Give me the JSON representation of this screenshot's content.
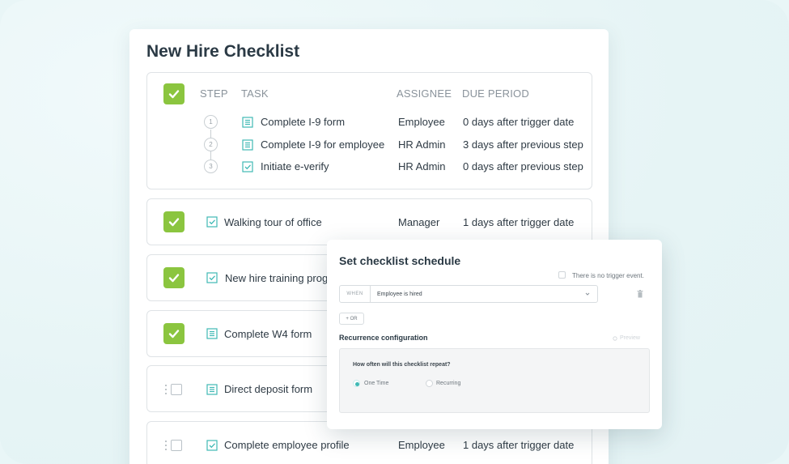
{
  "checklist": {
    "title": "New Hire Checklist",
    "headers": {
      "step": "STEP",
      "task": "TASK",
      "assignee": "ASSIGNEE",
      "due": "DUE PERIOD"
    },
    "group_steps": [
      {
        "num": "1",
        "icon": "form-icon",
        "task": "Complete I-9 form",
        "assignee": "Employee",
        "due": "0 days after trigger date"
      },
      {
        "num": "2",
        "icon": "form-icon",
        "task": "Complete I-9 for employee",
        "assignee": "HR Admin",
        "due": "3 days after previous step"
      },
      {
        "num": "3",
        "icon": "checkbox-task-icon",
        "task": "Initiate e-verify",
        "assignee": "HR Admin",
        "due": "0 days after previous step"
      }
    ],
    "items": [
      {
        "checked": true,
        "icon": "checkbox-task-icon",
        "task": "Walking tour of office",
        "assignee": "Manager",
        "due": "1 days after trigger date"
      },
      {
        "checked": true,
        "icon": "checkbox-task-icon",
        "task": "New hire training progr",
        "assignee": "",
        "due": ""
      },
      {
        "checked": true,
        "icon": "form-icon",
        "task": "Complete W4 form",
        "assignee": "",
        "due": ""
      },
      {
        "checked": false,
        "icon": "form-icon",
        "task": "Direct deposit form",
        "assignee": "",
        "due": ""
      },
      {
        "checked": false,
        "icon": "checkbox-task-icon",
        "task": "Complete employee profile",
        "assignee": "Employee",
        "due": "1 days after trigger date"
      }
    ]
  },
  "schedule_popup": {
    "title": "Set checklist schedule",
    "no_trigger_label": "There is no trigger event.",
    "when_tag": "WHEN",
    "when_value": "Employee is hired",
    "or_button": "+ OR",
    "recurrence_title": "Recurrence configuration",
    "preview_link": "Preview",
    "question": "How often will this checklist repeat?",
    "options": [
      {
        "label": "One Time",
        "selected": true
      },
      {
        "label": "Recurring",
        "selected": false
      }
    ]
  },
  "colors": {
    "check_green": "#8bc53f",
    "icon_teal": "#3fb9b5",
    "background": "#e9f6f7"
  }
}
